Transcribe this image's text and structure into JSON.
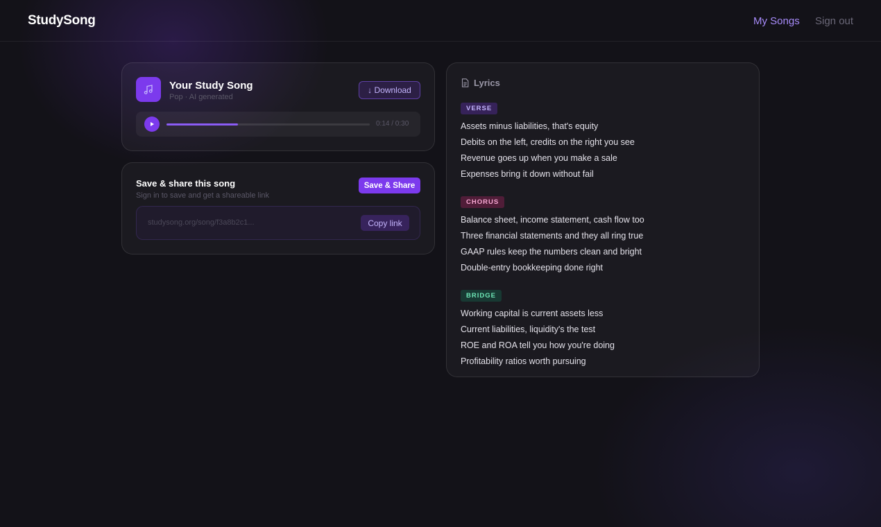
{
  "app": {
    "brand": "StudySong"
  },
  "nav": {
    "my_songs": "My Songs",
    "sign_out": "Sign out"
  },
  "player": {
    "title": "Your Study Song",
    "meta": "Pop · AI generated",
    "download_label": "↓ Download",
    "art_icon": "music-note-icon",
    "time": "0:14 / 0:30",
    "progress_fraction": 0.35,
    "accent_color": "#7c3aed"
  },
  "share": {
    "title": "Save & share this song",
    "subtitle": "Sign in to save and get a shareable link",
    "save_label": "Save & Share",
    "link_placeholder": "studysong.org/song/f3a8b2c1...",
    "copy_label": "Copy link"
  },
  "lyrics": {
    "heading": "Lyrics",
    "sections": [
      {
        "tag": "VERSE",
        "color": "#c4b5fd",
        "lines": [
          "Assets minus liabilities, that's equity",
          "Debits on the left, credits on the right you see",
          "Revenue goes up when you make a sale",
          "Expenses bring it down without fail"
        ]
      },
      {
        "tag": "CHORUS",
        "color": "#f9a8d4",
        "lines": [
          "Balance sheet, income statement, cash flow too",
          "Three financial statements and they all ring true",
          "GAAP rules keep the numbers clean and bright",
          "Double-entry bookkeeping done right"
        ]
      },
      {
        "tag": "BRIDGE",
        "color": "#6ee7b7",
        "lines": [
          "Working capital is current assets less",
          "Current liabilities, liquidity's the test",
          "ROE and ROA tell you how you're doing",
          "Profitability ratios worth pursuing"
        ]
      }
    ]
  }
}
